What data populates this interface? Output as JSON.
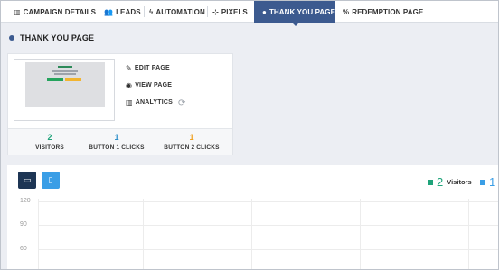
{
  "tabs": [
    {
      "label": "CAMPAIGN DETAILS",
      "icon": "bar-chart-icon",
      "glyph": "📊"
    },
    {
      "label": "LEADS",
      "icon": "users-icon",
      "glyph": "👥"
    },
    {
      "label": "AUTOMATION",
      "icon": "bolt-icon",
      "glyph": "ϟ"
    },
    {
      "label": "PIXELS",
      "icon": "crosshair-icon",
      "glyph": "⊹"
    },
    {
      "label": "THANK YOU PAGE",
      "icon": "circle-icon",
      "glyph": "●",
      "active": true
    },
    {
      "label": "REDEMPTION PAGE",
      "icon": "percent-icon",
      "glyph": "%"
    }
  ],
  "page": {
    "title": "THANK YOU PAGE"
  },
  "actions": {
    "edit": {
      "label": "EDIT PAGE",
      "glyph": "✎"
    },
    "view": {
      "label": "VIEW PAGE",
      "glyph": "◉"
    },
    "analytics": {
      "label": "ANALYTICS",
      "glyph": "▥"
    },
    "refresh_glyph": "⟳"
  },
  "stats": [
    {
      "value": "2",
      "label": "VISITORS",
      "color": "#1fa37a"
    },
    {
      "value": "1",
      "label": "BUTTON 1 CLICKS",
      "color": "#2d8fc9"
    },
    {
      "value": "1",
      "label": "BUTTON 2 CLICKS",
      "color": "#f0a020"
    }
  ],
  "chart_controls": {
    "desktop_glyph": "▭",
    "mobile_glyph": "▯"
  },
  "chart_data": {
    "type": "line",
    "y_ticks": [
      "120",
      "90",
      "60"
    ],
    "ylim": [
      60,
      120
    ],
    "grid": true,
    "legend_placement": "top-right",
    "series": [
      {
        "name": "Visitors",
        "total": "2",
        "color": "#1fa37a"
      },
      {
        "name": "",
        "total": "1",
        "color": "#3a9ee6"
      }
    ]
  }
}
